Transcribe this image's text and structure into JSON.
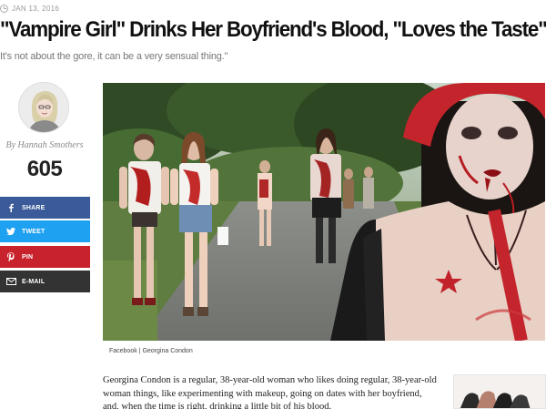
{
  "article": {
    "date": "JAN 13, 2016",
    "headline": "\"Vampire Girl\" Drinks Her Boyfriend's Blood, \"Loves the Taste\"",
    "subheadline": "It's not about the gore, it can be a very sensual thing.\""
  },
  "author": {
    "name": "By Hannah Smothers",
    "share_count": "605"
  },
  "share": {
    "facebook_label": "SHARE",
    "twitter_label": "TWEET",
    "pinterest_label": "PIN",
    "email_label": "E-MAIL"
  },
  "photo": {
    "credit": "Facebook | Georgina Condon"
  },
  "body": {
    "paragraph": "Georgina Condon is a regular, 38-year-old woman who likes doing regular, 38-year-old woman things, like experimenting with makeup, going on dates with her boyfriend, and, when the time is right, drinking a little bit of his blood."
  },
  "colors": {
    "facebook": "#3b5a9a",
    "twitter": "#1fa1f1",
    "pinterest": "#c8232c",
    "email": "#333333"
  },
  "icons": {
    "date": "clock-icon",
    "facebook": "facebook-icon",
    "twitter": "twitter-icon",
    "pinterest": "pinterest-icon",
    "email": "email-icon"
  }
}
